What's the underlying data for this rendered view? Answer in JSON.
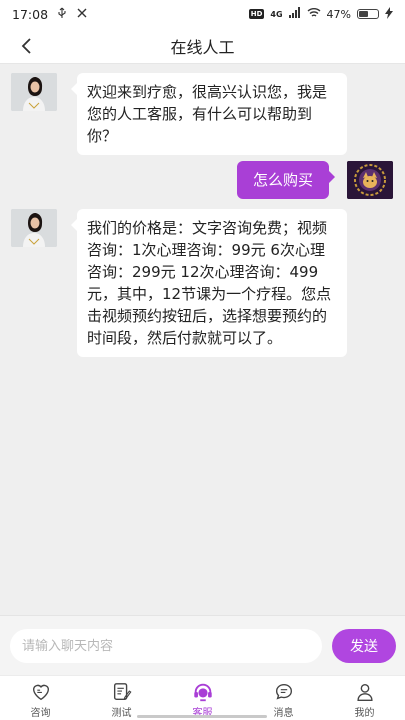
{
  "status_bar": {
    "time": "17:08",
    "battery_percent": "47%"
  },
  "header": {
    "title": "在线人工"
  },
  "messages": [
    {
      "sender": "agent",
      "text": "欢迎来到疗愈，很高兴认识您，我是您的人工客服，有什么可以帮助到你？"
    },
    {
      "sender": "user",
      "text": "怎么购买"
    },
    {
      "sender": "agent",
      "text": "我们的价格是：文字咨询免费；视频咨询：1次心理咨询：99元 6次心理咨询：299元 12次心理咨询：499元，其中，12节课为一个疗程。您点击视频预约按钮后，选择想要预约的时间段，然后付款就可以了。"
    }
  ],
  "composer": {
    "placeholder": "请输入聊天内容",
    "send_label": "发送"
  },
  "tabs": [
    {
      "label": "咨询",
      "icon": "heart-chat-icon",
      "active": false
    },
    {
      "label": "测试",
      "icon": "edit-note-icon",
      "active": false
    },
    {
      "label": "客服",
      "icon": "headset-agent-icon",
      "active": true
    },
    {
      "label": "消息",
      "icon": "message-bubble-icon",
      "active": false
    },
    {
      "label": "我的",
      "icon": "user-icon",
      "active": false
    }
  ],
  "colors": {
    "accent": "#a93fd6",
    "send_button": "#b046e0",
    "chat_background": "#efefef"
  }
}
